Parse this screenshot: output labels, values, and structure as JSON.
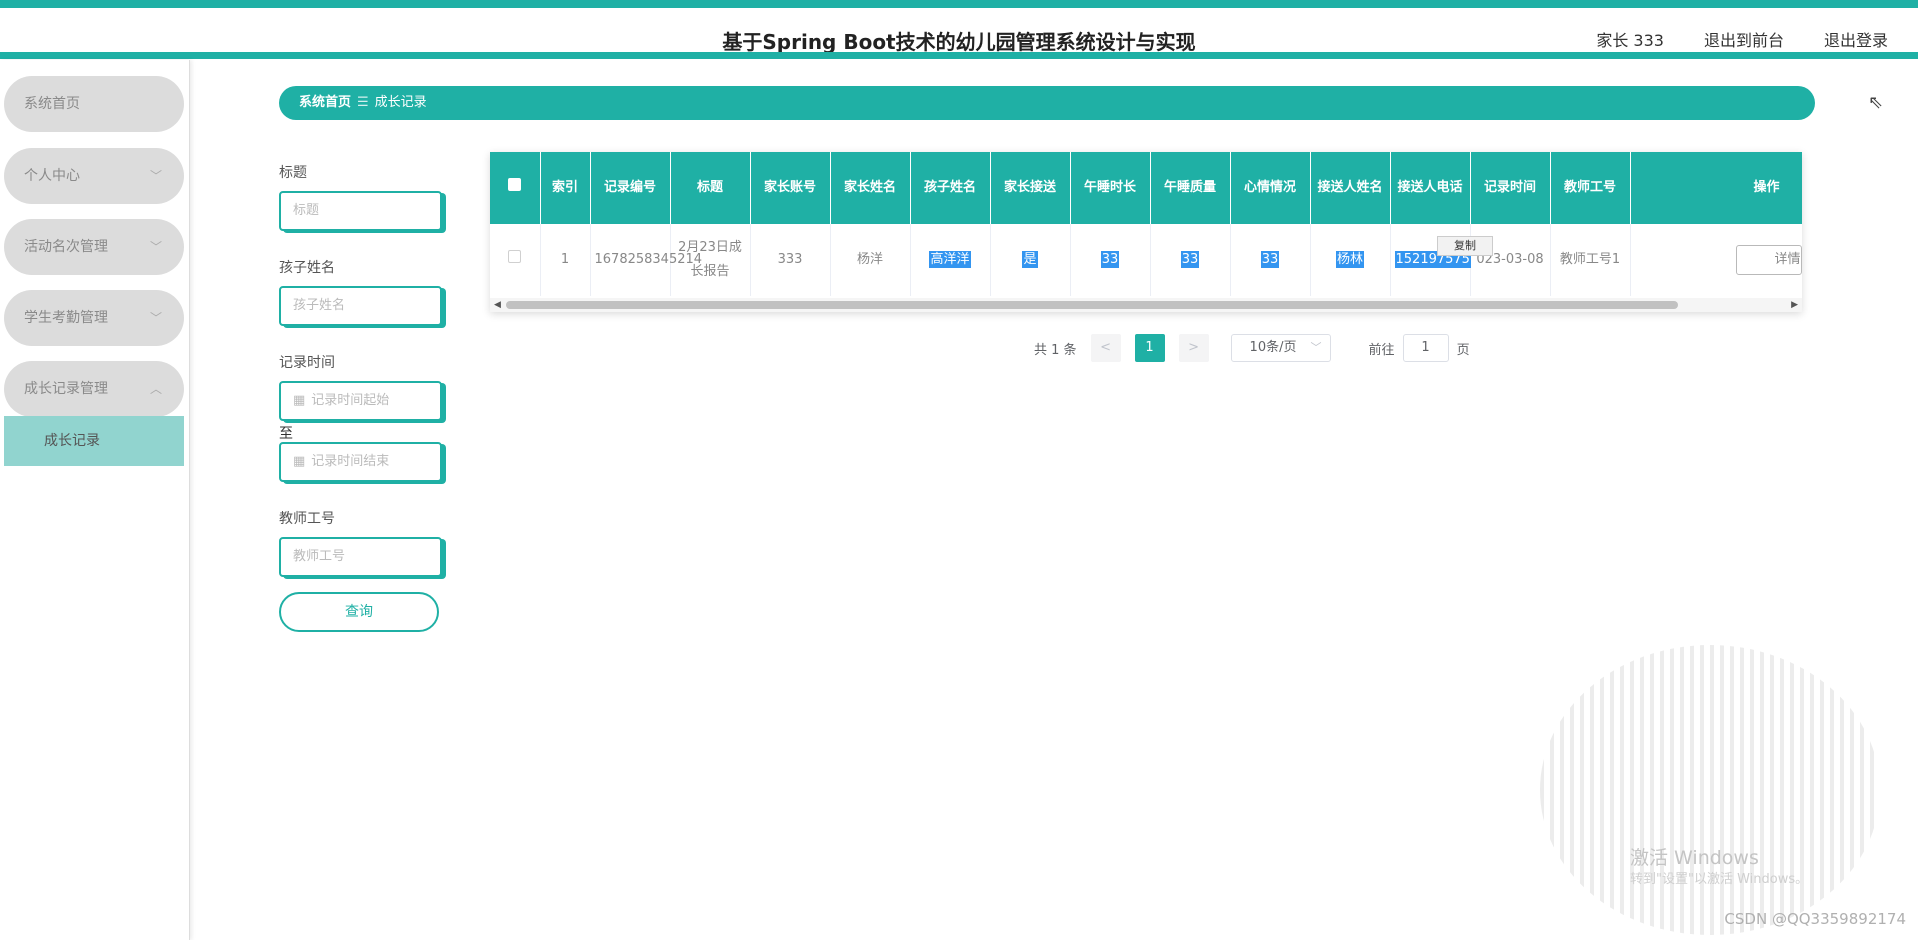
{
  "header": {
    "title": "基于Spring Boot技术的幼儿园管理系统设计与实现",
    "user": "家长 333",
    "to_front": "退出到前台",
    "logout": "退出登录"
  },
  "sidebar": {
    "items": [
      {
        "label": "系统首页"
      },
      {
        "label": "个人中心"
      },
      {
        "label": "活动名次管理"
      },
      {
        "label": "学生考勤管理"
      },
      {
        "label": "成长记录管理"
      }
    ],
    "sub_active": "成长记录"
  },
  "breadcrumb": {
    "home": "系统首页",
    "current": "成长记录"
  },
  "filters": {
    "title_label": "标题",
    "title_placeholder": "标题",
    "child_label": "孩子姓名",
    "child_placeholder": "孩子姓名",
    "time_label": "记录时间",
    "time_start": "记录时间起始",
    "to": "至",
    "time_end": "记录时间结束",
    "teacher_label": "教师工号",
    "teacher_placeholder": "教师工号",
    "query": "查询"
  },
  "table": {
    "headers": [
      "索引",
      "记录编号",
      "标题",
      "家长账号",
      "家长姓名",
      "孩子姓名",
      "家长接送",
      "午睡时长",
      "午睡质量",
      "心情情况",
      "接送人姓名",
      "接送人电话",
      "记录时间",
      "教师工号",
      "操作"
    ],
    "row": {
      "index": "1",
      "record_no": "1678258345214",
      "title": "2月23日成长报告",
      "parent_account": "333",
      "parent_name": "杨洋",
      "child_name": "高洋洋",
      "pickup": "是",
      "nap_duration": "33",
      "nap_quality": "33",
      "mood": "33",
      "pickup_person": "杨林",
      "pickup_phone": "152197575",
      "record_time": "023-03-08",
      "teacher_no": "教师工号1",
      "action": "详情"
    },
    "copy_tooltip": "复制"
  },
  "pagination": {
    "total": "共 1 条",
    "prev": "<",
    "current": "1",
    "next": ">",
    "page_size": "10条/页",
    "goto": "前往",
    "goto_value": "1",
    "page_unit": "页"
  },
  "watermark": {
    "line1": "激活 Windows",
    "line2": "转到\"设置\"以激活 Windows。",
    "csdn": "CSDN @QQ3359892174"
  }
}
